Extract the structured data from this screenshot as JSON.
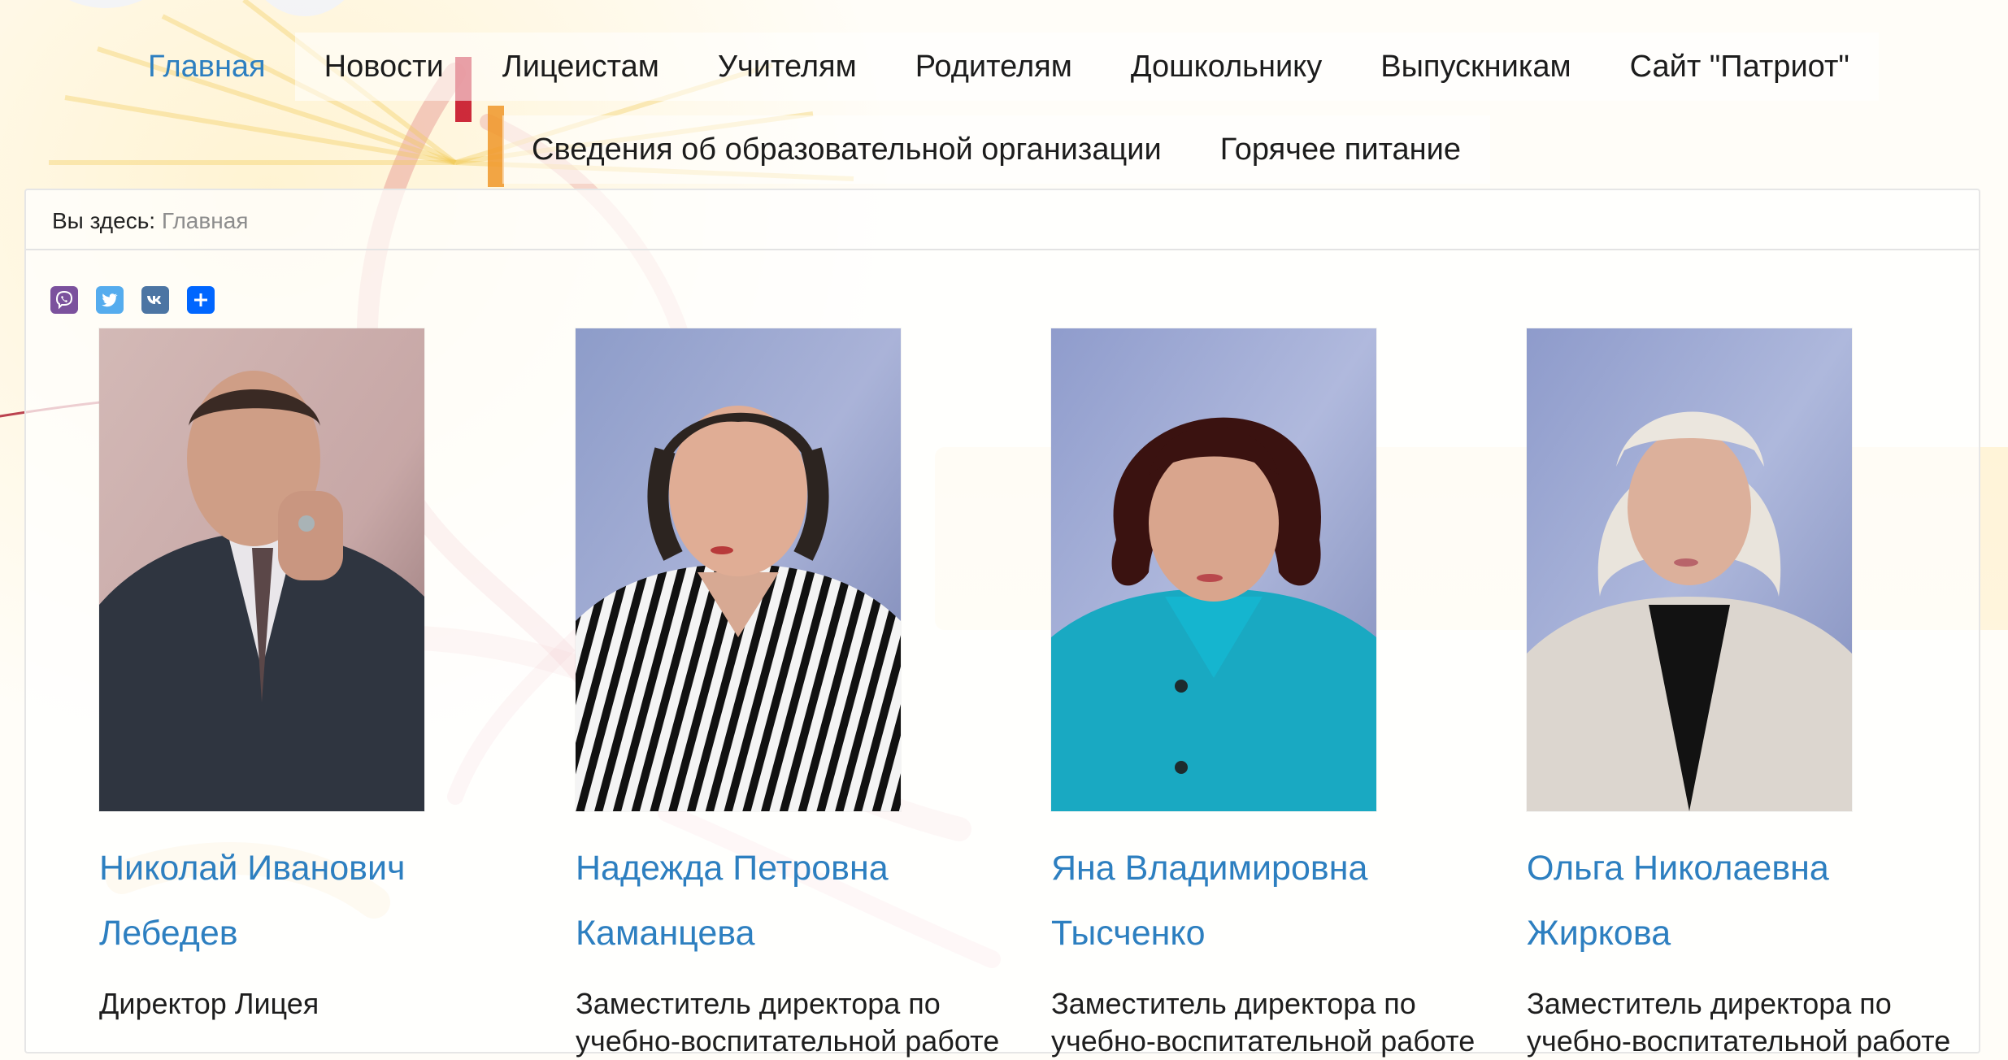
{
  "nav": {
    "row1": [
      {
        "label": "Главная",
        "active": true
      },
      {
        "label": "Новости"
      },
      {
        "label": "Лицеистам"
      },
      {
        "label": "Учителям"
      },
      {
        "label": "Родителям"
      },
      {
        "label": "Дошкольнику"
      },
      {
        "label": "Выпускникам"
      },
      {
        "label": "Сайт \"Патриот\""
      }
    ],
    "row2": [
      {
        "label": "Сведения об образовательной организации"
      },
      {
        "label": "Горячее питание"
      }
    ]
  },
  "breadcrumb": {
    "prefix": "Вы здесь:",
    "current": "Главная"
  },
  "share": {
    "icons": [
      "viber-icon",
      "twitter-icon",
      "vk-icon",
      "share-plus-icon"
    ]
  },
  "staff": [
    {
      "first": "Николай Иванович",
      "last": "Лебедев",
      "position": "Директор Лицея"
    },
    {
      "first": "Надежда Петровна",
      "last": "Каманцева",
      "position": "Заместитель директора по учебно-воспитательной работе"
    },
    {
      "first": "Яна Владимировна",
      "last": "Тысченко",
      "position": "Заместитель директора по учебно-воспитательной работе"
    },
    {
      "first": "Ольга Николаевна",
      "last": "Жиркова",
      "position": "Заместитель директора по учебно-воспитательной работе"
    }
  ],
  "colors": {
    "link": "#2d7fc0",
    "viber": "#7b519d",
    "twitter": "#55acee",
    "vk": "#4c75a3",
    "share": "#0066ff"
  }
}
